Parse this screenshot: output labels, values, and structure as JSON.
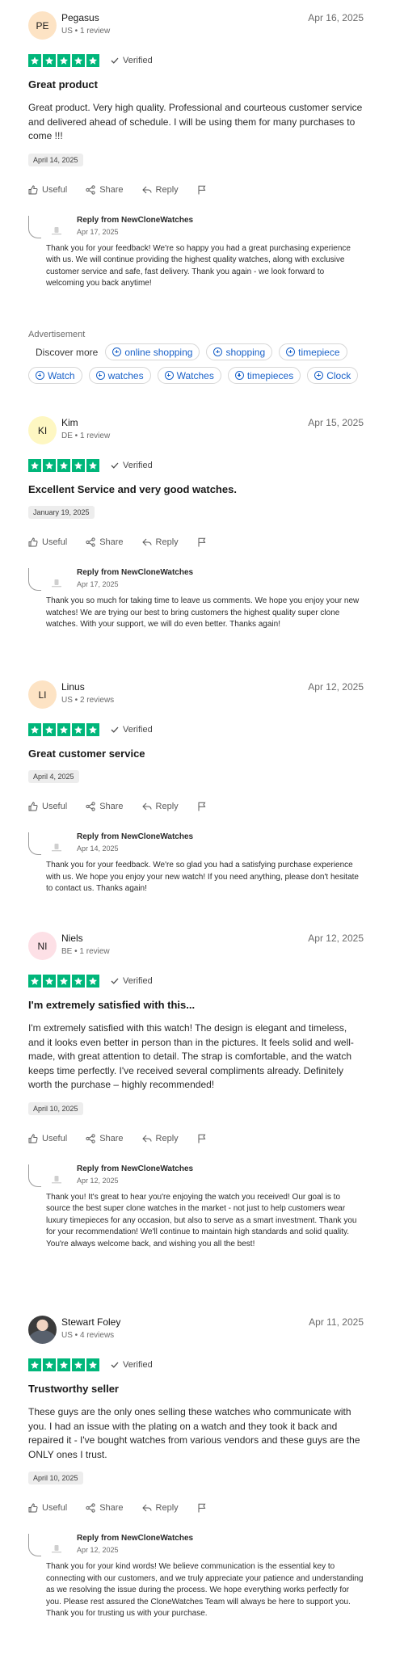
{
  "reviews": [
    {
      "initials": "PE",
      "avatar_color": "#fde3c4",
      "name": "Pegasus",
      "meta": "US • 1 review",
      "date": "Apr 16, 2025",
      "verified": "Verified",
      "rating": 5,
      "title": "Great product",
      "body": "Great product. Very high quality. Professional and courteous customer service and delivered ahead of schedule. I will be using them for many purchases to come !!!",
      "experience_date": "April 14, 2025",
      "actions": {
        "useful": "Useful",
        "share": "Share",
        "reply": "Reply"
      },
      "reply": {
        "from": "Reply from NewCloneWatches",
        "date": "Apr 17, 2025",
        "text": "Thank you for your feedback! We're so happy you had a great purchasing experience with us. We will continue providing the highest quality watches, along with exclusive customer service and safe, fast delivery. Thank you again - we look forward to welcoming you back anytime!"
      }
    },
    {
      "initials": "KI",
      "avatar_color": "#fef7c2",
      "name": "Kim",
      "meta": "DE • 1 review",
      "date": "Apr 15, 2025",
      "verified": "Verified",
      "rating": 5,
      "title": "Excellent Service and very good watches.",
      "body": "",
      "experience_date": "January 19, 2025",
      "actions": {
        "useful": "Useful",
        "share": "Share",
        "reply": "Reply"
      },
      "reply": {
        "from": "Reply from NewCloneWatches",
        "date": "Apr 17, 2025",
        "text": "Thank you so much for taking time to leave us comments. We hope you enjoy your new watches! We are trying our best to bring customers the highest quality super clone watches. With your support, we will do even better. Thanks again!"
      }
    },
    {
      "initials": "LI",
      "avatar_color": "#fde3c4",
      "name": "Linus",
      "meta": "US • 2 reviews",
      "date": "Apr 12, 2025",
      "verified": "Verified",
      "rating": 5,
      "title": "Great customer service",
      "body": "",
      "experience_date": "April 4, 2025",
      "actions": {
        "useful": "Useful",
        "share": "Share",
        "reply": "Reply"
      },
      "reply": {
        "from": "Reply from NewCloneWatches",
        "date": "Apr 14, 2025",
        "text": "Thank you for your feedback. We're so glad you had a satisfying purchase experience with us. We hope you enjoy your new watch! If you need anything, please don't hesitate to contact us. Thanks again!"
      }
    },
    {
      "initials": "NI",
      "avatar_color": "#fde0e6",
      "name": "Niels",
      "meta": "BE • 1 review",
      "date": "Apr 12, 2025",
      "verified": "Verified",
      "rating": 5,
      "title": "I'm extremely satisfied with this...",
      "body": "I'm extremely satisfied with this watch! The design is elegant and timeless, and it looks even better in person than in the pictures. It feels solid and well-made, with great attention to detail. The strap is comfortable, and the watch keeps time perfectly. I've received several compliments already. Definitely worth the purchase – highly recommended!",
      "experience_date": "April 10, 2025",
      "actions": {
        "useful": "Useful",
        "share": "Share",
        "reply": "Reply"
      },
      "reply": {
        "from": "Reply from NewCloneWatches",
        "date": "Apr 12, 2025",
        "text": "Thank you! It's great to hear you're enjoying the watch you received! Our goal is to source the best super clone watches in the market - not just to help customers wear luxury timepieces for any occasion, but also to serve as a smart investment. Thank you for your recommendation! We'll continue to maintain high standards and solid quality. You're always welcome back, and wishing you all the best!"
      }
    },
    {
      "initials": "",
      "avatar_color": "#3b3b3b",
      "name": "Stewart Foley",
      "meta": "US • 4 reviews",
      "date": "Apr 11, 2025",
      "verified": "Verified",
      "rating": 5,
      "title": "Trustworthy seller",
      "body": "These guys are the only ones selling these watches who communicate with you. I had an issue with the plating on a watch and they took it back and repaired it - I've bought watches from various vendors and these guys are the ONLY ones I trust.",
      "experience_date": "April 10, 2025",
      "actions": {
        "useful": "Useful",
        "share": "Share",
        "reply": "Reply"
      },
      "reply": {
        "from": "Reply from NewCloneWatches",
        "date": "Apr 12, 2025",
        "text": "Thank you for your kind words! We believe communication is the essential key to connecting with our customers, and we truly appreciate your patience and understanding as we resolving the issue during the process. We hope everything works perfectly for you. Please rest assured the CloneWatches Team will always be here to support you. Thank you for trusting us with your purchase."
      }
    }
  ],
  "advertisement": {
    "label": "Advertisement",
    "discover": "Discover more",
    "row1": [
      "online shopping",
      "shopping",
      "timepiece"
    ],
    "row2": [
      "Watch",
      "watches",
      "Watches",
      "timepieces",
      "Clock"
    ]
  },
  "colors": {
    "star_green": "#00b67a",
    "link_blue": "#1a62c9"
  }
}
